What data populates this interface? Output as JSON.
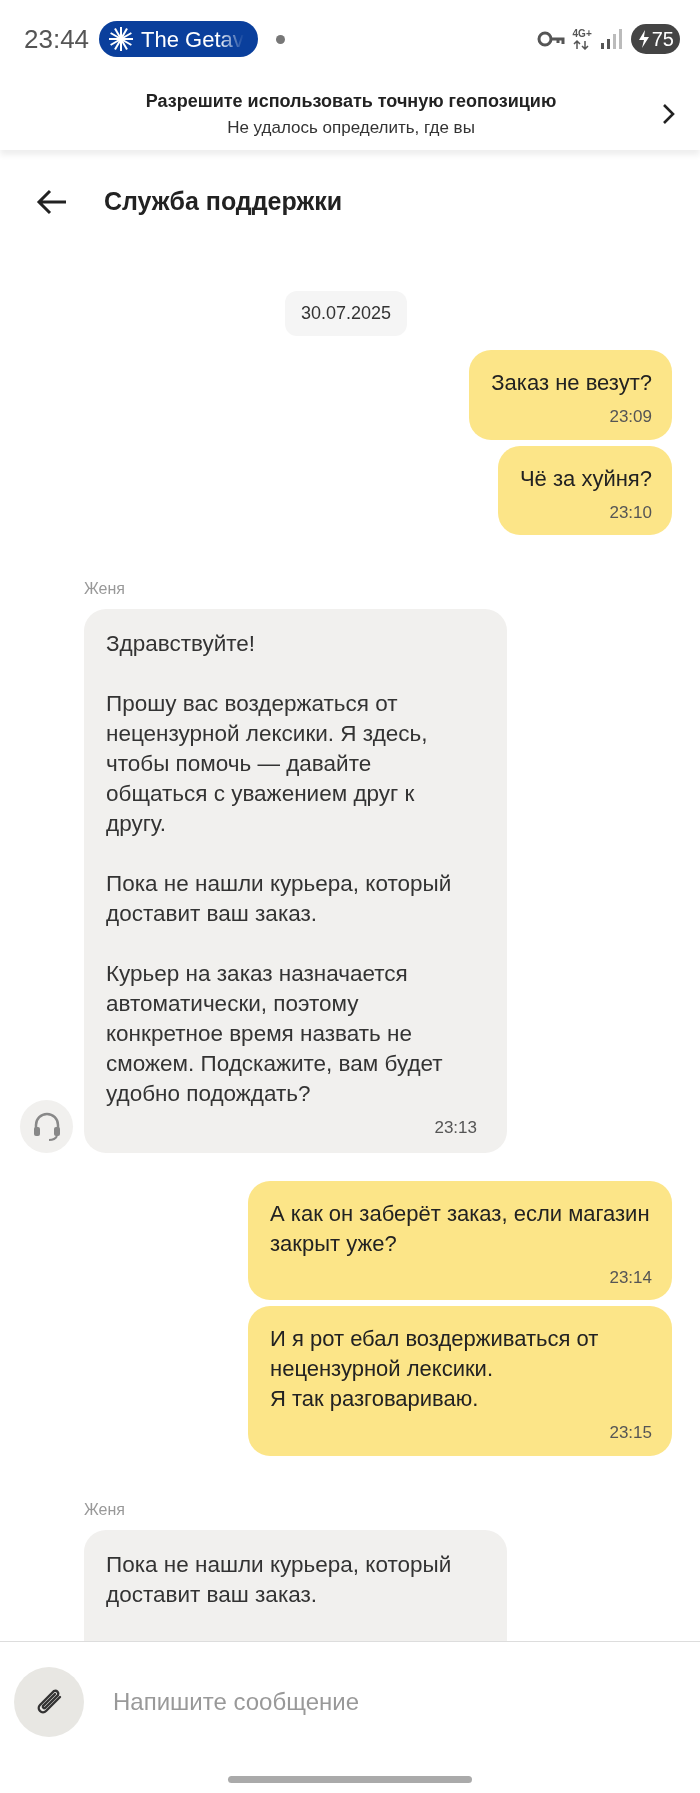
{
  "status_bar": {
    "time": "23:44",
    "notification": {
      "label": "The Getav"
    },
    "network": "4G+",
    "battery": "75"
  },
  "location_banner": {
    "title": "Разрешите использовать точную геопозицию",
    "subtitle": "Не удалось определить, где вы"
  },
  "header": {
    "title": "Служба поддержки"
  },
  "messages": [
    {
      "kind": "date",
      "text": "30.07.2025"
    },
    {
      "kind": "outgoing",
      "text": "Заказ не везут?",
      "time": "23:09"
    },
    {
      "kind": "outgoing",
      "text": "Чё за хуйня?",
      "time": "23:10"
    },
    {
      "kind": "incoming",
      "sender": "Женя",
      "text": "Здравствуйте!\n\nПрошу вас воздержаться от нецензурной лексики. Я здесь, чтобы помочь — давайте общаться с уважением друг к другу.\n\nПока не нашли курьера, который доставит ваш заказ.\n\nКурьер на заказ назначается автоматически, поэтому конкретное время назвать не сможем. Подскажите, вам будет удобно подождать?",
      "time": "23:13",
      "avatar": true
    },
    {
      "kind": "outgoing",
      "text": "А как он заберёт заказ, если магазин закрыт уже?",
      "time": "23:14"
    },
    {
      "kind": "outgoing",
      "text": "И я рот ебал воздерживаться от нецензурной лексики.\nЯ так разговариваю.",
      "time": "23:15"
    },
    {
      "kind": "incoming",
      "sender": "Женя",
      "text": "Пока не нашли курьера, который доставит ваш заказ.",
      "avatar": false
    }
  ],
  "composer": {
    "placeholder": "Напишите сообщение"
  }
}
